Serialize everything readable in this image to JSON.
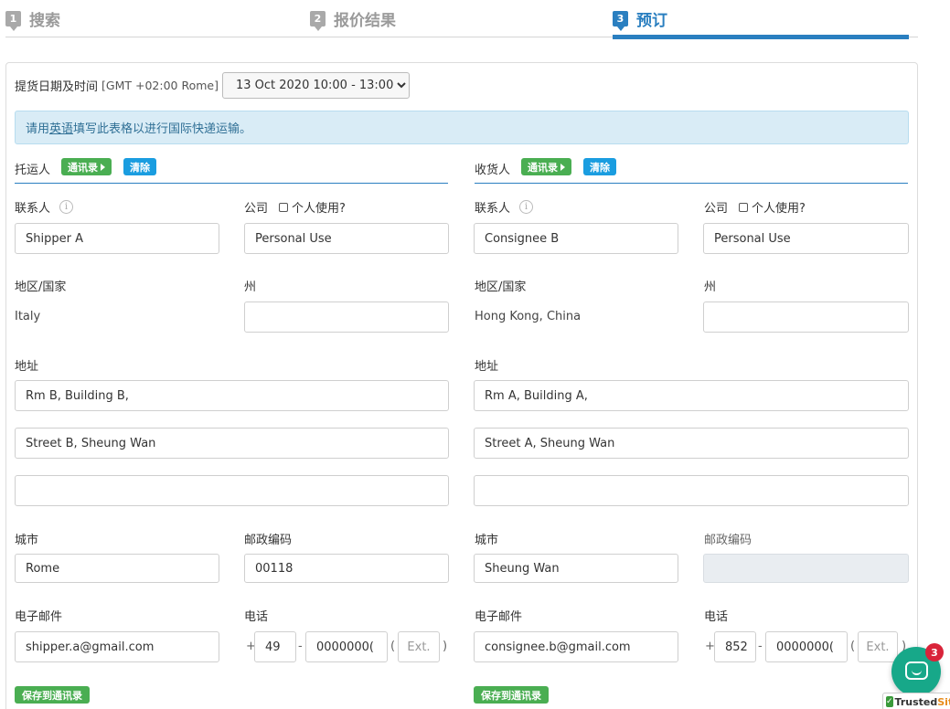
{
  "steps": [
    {
      "num": "1",
      "label": "搜索"
    },
    {
      "num": "2",
      "label": "报价结果"
    },
    {
      "num": "3",
      "label": "预订"
    }
  ],
  "pickup": {
    "label": "提货日期及时间",
    "timezone": "[GMT +02:00 Rome]",
    "selected": "13 Oct 2020 10:00 - 13:00"
  },
  "notice": {
    "before": "请用",
    "link": "英语",
    "after": "填写此表格以进行国际快递运输。"
  },
  "labels": {
    "contact": "联系人",
    "company": "公司",
    "personal_use": "个人使用?",
    "country": "地区/国家",
    "state": "州",
    "address": "地址",
    "city": "城市",
    "postcode": "邮政编码",
    "email": "电子邮件",
    "phone": "电话",
    "address_book": "通讯录",
    "clear": "清除",
    "save_address_book": "保存到通讯录",
    "ext_placeholder": "Ext.",
    "plus": "+",
    "dash": "-",
    "paren_open": "(",
    "paren_close": ")"
  },
  "shipper": {
    "title": "托运人",
    "contact": "Shipper A",
    "company": "Personal Use",
    "country": "Italy",
    "state": "",
    "address1": "Rm B, Building B,",
    "address2": "Street B, Sheung Wan",
    "address3": "",
    "city": "Rome",
    "postcode": "00118",
    "email": "shipper.a@gmail.com",
    "phone_code": "49",
    "phone_number": "0000000(",
    "ext": ""
  },
  "consignee": {
    "title": "收货人",
    "contact": "Consignee B",
    "company": "Personal Use",
    "country": "Hong Kong, China",
    "state": "",
    "address1": "Rm A, Building A,",
    "address2": "Street A, Sheung Wan",
    "address3": "",
    "city": "Sheung Wan",
    "postcode": "",
    "email": "consignee.b@gmail.com",
    "phone_code": "852",
    "phone_number": "0000000(",
    "ext": ""
  },
  "chat": {
    "unread": "3"
  },
  "trusted": {
    "part1": "Trusted",
    "part2": "Site"
  },
  "colors": {
    "accent": "#2a7fc0",
    "green": "#4aae52",
    "blue": "#1a9de0",
    "chat": "#17a889"
  }
}
